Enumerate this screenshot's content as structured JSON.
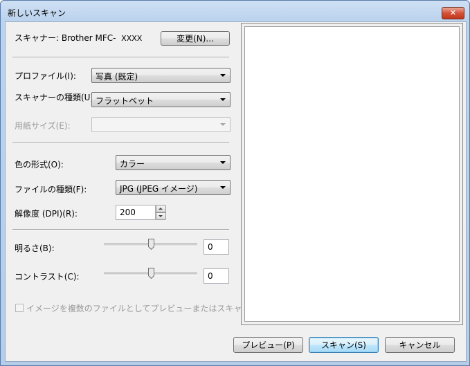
{
  "window": {
    "title": "新しいスキャン",
    "close_glyph": "✕"
  },
  "scanner": {
    "label": "スキャナー: Brother MFC-",
    "model": "XXXX",
    "change_button": "変更(N)..."
  },
  "profile": {
    "label": "プロファイル(I):",
    "value": "写真 (既定)"
  },
  "source": {
    "label": "スキャナーの種類(U):",
    "value": "フラットベット"
  },
  "paper_size": {
    "label": "用紙サイズ(E):",
    "value": ""
  },
  "color_format": {
    "label": "色の形式(O):",
    "value": "カラー"
  },
  "file_type": {
    "label": "ファイルの種類(F):",
    "value": "JPG (JPEG イメージ)"
  },
  "resolution": {
    "label": "解像度 (DPI)(R):",
    "value": "200"
  },
  "brightness": {
    "label": "明るさ(B):",
    "value": "0",
    "level": 0
  },
  "contrast": {
    "label": "コントラスト(C):",
    "value": "0",
    "level": 0
  },
  "multi_file": {
    "label": "イメージを複数のファイルとしてプレビューまたはスキャンする(T)",
    "checked": false
  },
  "buttons": {
    "preview": "プレビュー(P)",
    "scan": "スキャン(S)",
    "cancel": "キャンセル"
  }
}
